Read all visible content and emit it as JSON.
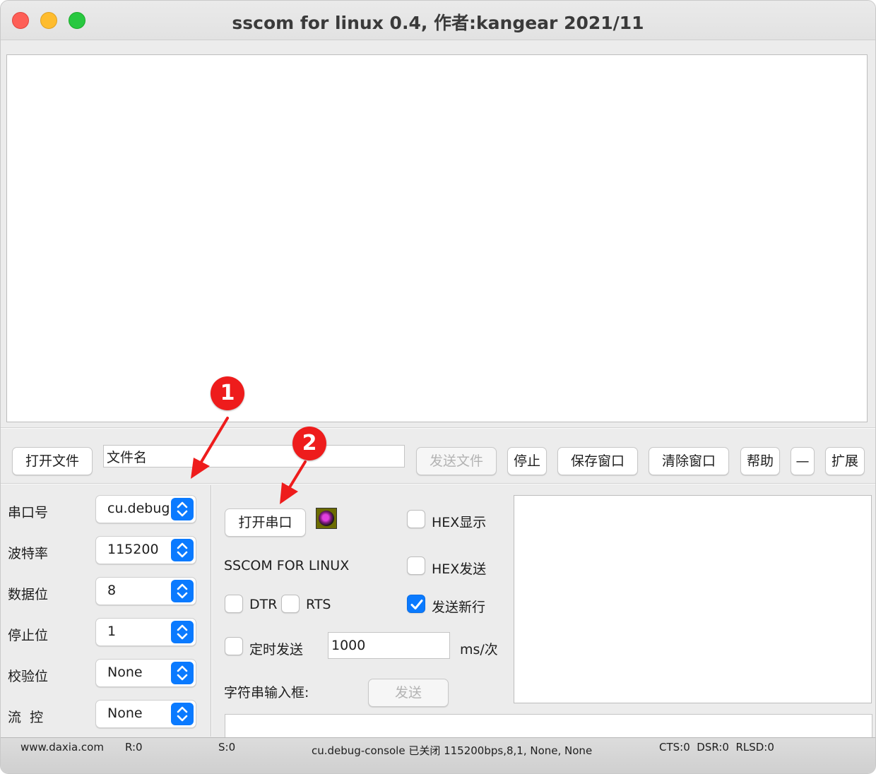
{
  "window": {
    "title": "sscom for linux 0.4, 作者:kangear 2021/11"
  },
  "file_bar": {
    "open_file": "打开文件",
    "filename_value": "文件名",
    "send_file": "发送文件",
    "stop": "停止",
    "save_window": "保存窗口",
    "clear_window": "清除窗口",
    "help": "帮助",
    "minus": "—",
    "expand": "扩展"
  },
  "serial_settings": [
    {
      "label": "串口号",
      "value": "cu.debug"
    },
    {
      "label": "波特率",
      "value": "115200"
    },
    {
      "label": "数据位",
      "value": "8"
    },
    {
      "label": "停止位",
      "value": "1"
    },
    {
      "label": "校验位",
      "value": "None"
    },
    {
      "label": "流  控",
      "value": "None"
    }
  ],
  "center": {
    "open_port": "打开串口",
    "brand": "SSCOM FOR LINUX",
    "dtr": "DTR",
    "rts": "RTS",
    "timed_send": "定时发送",
    "interval_value": "1000",
    "interval_unit": "ms/次",
    "string_input_label": "字符串输入框:",
    "send": "发送"
  },
  "options": {
    "hex_display": "HEX显示",
    "hex_send": "HEX发送",
    "send_newline": "发送新行",
    "hex_display_checked": false,
    "hex_send_checked": false,
    "send_newline_checked": true,
    "dtr_checked": false,
    "rts_checked": false,
    "timed_send_checked": false
  },
  "status_bar": {
    "site": "www.daxia.com",
    "received": "R:0",
    "sent": "S:0",
    "port_status": "cu.debug-console 已关闭 115200bps,8,1, None, None",
    "signals": "CTS:0  DSR:0  RLSD:0"
  },
  "annotations": {
    "badge_1": "1",
    "badge_2": "2",
    "color": "#ee1c1c"
  },
  "colors": {
    "accent": "#0a7aff",
    "close": "#fe5f57",
    "minimize": "#febc2e",
    "maximize": "#28c840"
  }
}
